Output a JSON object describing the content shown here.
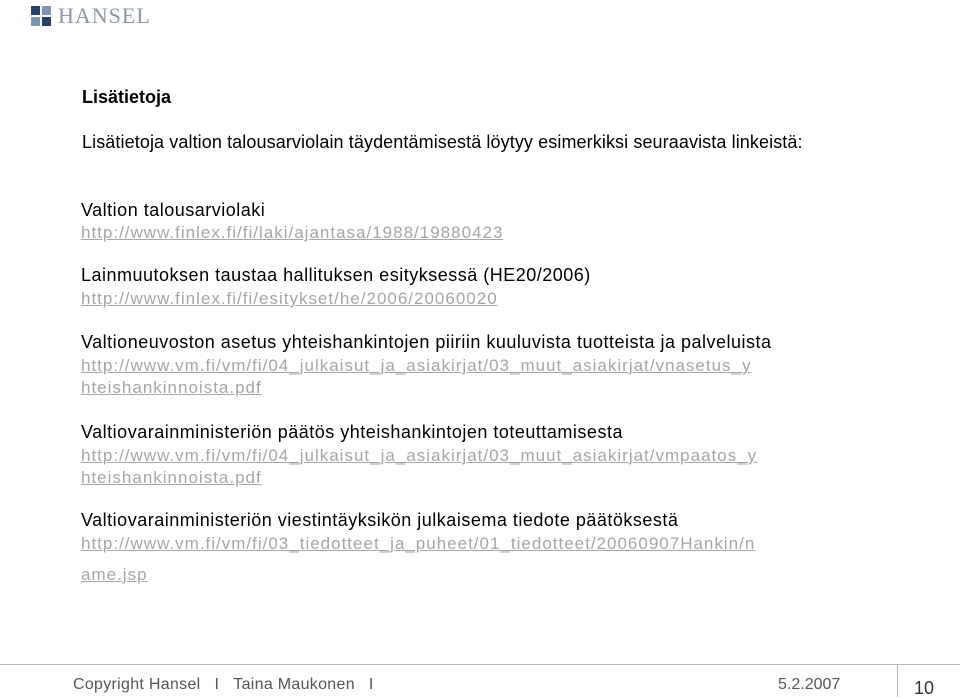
{
  "logo": {
    "text": "HANSEL"
  },
  "heading": "Lisätietoja",
  "intro": "Lisätietoja valtion talousarviolain täydentämisestä löytyy esimerkiksi seuraavista linkeistä:",
  "sections": [
    {
      "title": "Valtion talousarviolaki",
      "link_lines": [
        "http://www.finlex.fi/fi/laki/ajantasa/1988/19880423"
      ]
    },
    {
      "title": "Lainmuutoksen taustaa hallituksen esityksessä (HE20/2006)",
      "link_lines": [
        "http://www.finlex.fi/fi/esitykset/he/2006/20060020"
      ]
    },
    {
      "title": "Valtioneuvoston asetus yhteishankintojen piiriin kuuluvista tuotteista ja palveluista",
      "link_lines": [
        "http://www.vm.fi/vm/fi/04_julkaisut_ja_asiakirjat/03_muut_asiakirjat/vnasetus_y",
        "hteishankinnoista.pdf"
      ]
    },
    {
      "title": "Valtiovarainministeriön päätös yhteishankintojen toteuttamisesta",
      "link_lines": [
        "http://www.vm.fi/vm/fi/04_julkaisut_ja_asiakirjat/03_muut_asiakirjat/vmpaatos_y",
        "hteishankinnoista.pdf"
      ]
    },
    {
      "title": "Valtiovarainministeriön viestintäyksikön julkaisema tiedote päätöksestä",
      "link_lines": [
        "http://www.vm.fi/vm/fi/03_tiedotteet_ja_puheet/01_tiedotteet/20060907Hankin/n",
        "ame.jsp"
      ]
    }
  ],
  "footer": {
    "copyright": "Copyright Hansel",
    "separator": "I",
    "author": "Taina Maukonen",
    "date": "5.2.2007",
    "page_number": "10"
  }
}
